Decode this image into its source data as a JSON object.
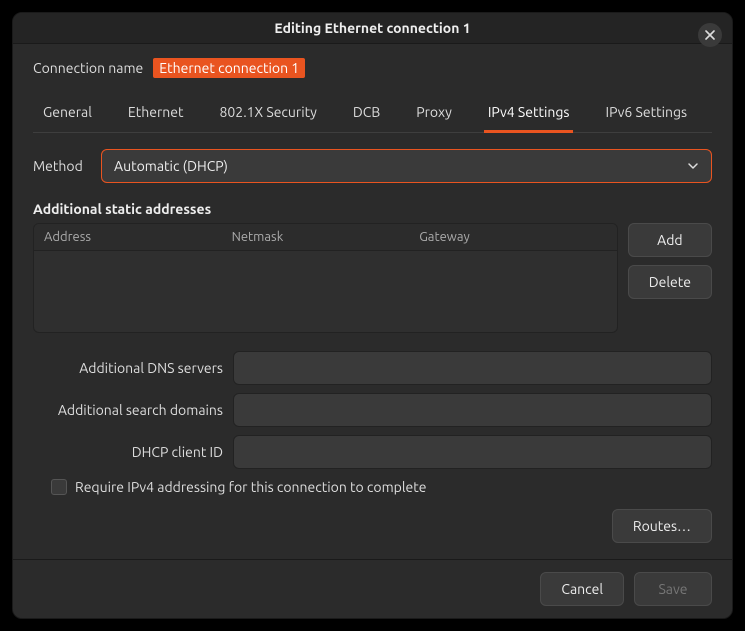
{
  "title": "Editing Ethernet connection 1",
  "connection": {
    "label": "Connection name",
    "value": "Ethernet connection 1"
  },
  "tabs": {
    "general": "General",
    "ethernet": "Ethernet",
    "security": "802.1X Security",
    "dcb": "DCB",
    "proxy": "Proxy",
    "ipv4": "IPv4 Settings",
    "ipv6": "IPv6 Settings",
    "active": "ipv4"
  },
  "method": {
    "label": "Method",
    "selected": "Automatic (DHCP)"
  },
  "addresses": {
    "header": "Additional static addresses",
    "columns": {
      "address": "Address",
      "netmask": "Netmask",
      "gateway": "Gateway"
    },
    "rows": [],
    "add": "Add",
    "delete": "Delete"
  },
  "fields": {
    "dns_label": "Additional DNS servers",
    "dns_value": "",
    "search_label": "Additional search domains",
    "search_value": "",
    "dhcp_label": "DHCP client ID",
    "dhcp_value": ""
  },
  "require": {
    "label": "Require IPv4 addressing for this connection to complete",
    "checked": false
  },
  "routes": "Routes…",
  "footer": {
    "cancel": "Cancel",
    "save": "Save"
  }
}
